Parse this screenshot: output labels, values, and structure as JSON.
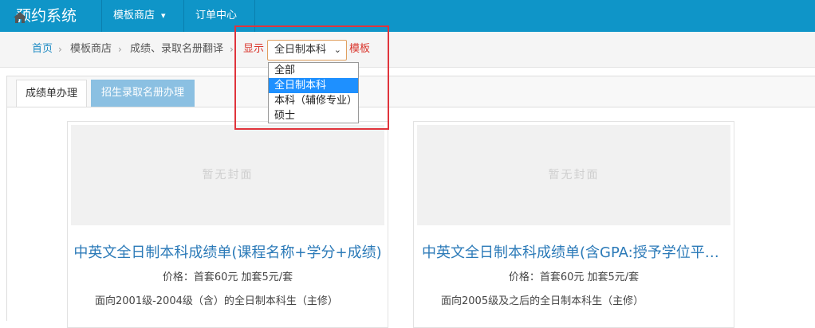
{
  "app": {
    "title": "预约系统"
  },
  "nav": {
    "items": [
      {
        "label": "模板商店"
      },
      {
        "label": "订单中心"
      }
    ]
  },
  "breadcrumb": {
    "home": "首页",
    "store": "模板商店",
    "current": "成绩、录取名册翻译",
    "show_label": "显示",
    "template_label": "模板"
  },
  "filter": {
    "selected": "全日制本科",
    "options": [
      "全部",
      "全日制本科",
      "本科（辅修专业）",
      "硕士"
    ]
  },
  "tabs": [
    {
      "label": "成绩单办理"
    },
    {
      "label": "招生录取名册办理"
    }
  ],
  "cards": [
    {
      "cover_text": "暂无封面",
      "title": "中英文全日制本科成绩单(课程名称+学分+成绩)",
      "price": "价格：首套60元 加套5元/套",
      "desc": "面向2001级-2004级（含）的全日制本科生（主修）"
    },
    {
      "cover_text": "暂无封面",
      "title": "中英文全日制本科成绩单(含GPA:授予学位平均成绩)",
      "price": "价格：首套60元 加套5元/套",
      "desc": "面向2005级及之后的全日制本科生（主修）"
    }
  ],
  "colors": {
    "topbar": "#0f95c8",
    "highlight_frame": "#e0343c",
    "link": "#1e8bc3",
    "card_title": "#2b7ab8"
  }
}
